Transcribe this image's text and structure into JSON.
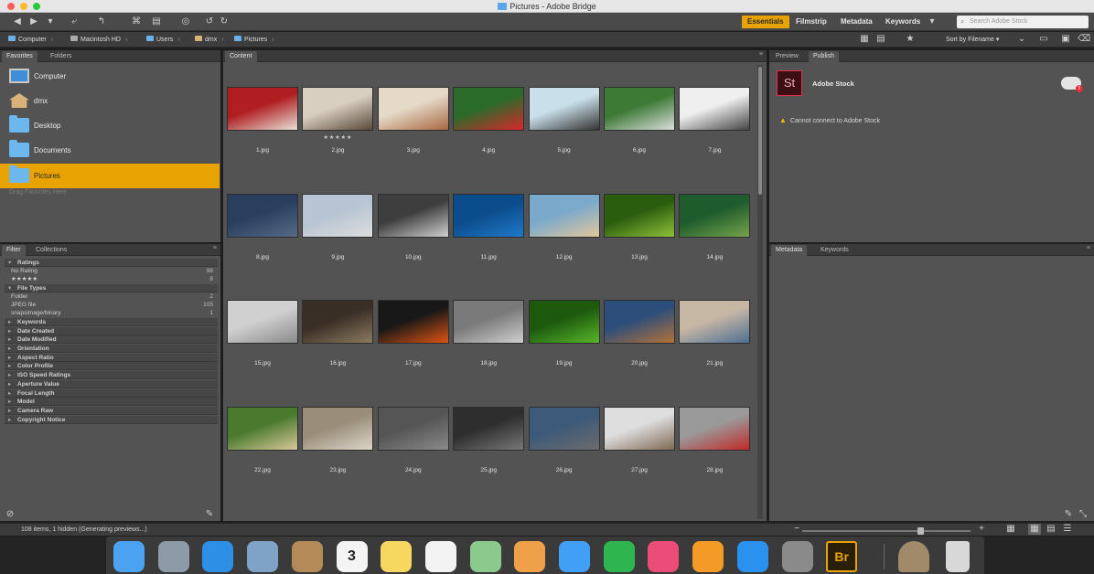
{
  "window": {
    "title": "Pictures - Adobe Bridge"
  },
  "toolbar": {
    "workspaces": [
      "Essentials",
      "Filmstrip",
      "Metadata",
      "Keywords"
    ],
    "active_workspace": "Essentials",
    "search_placeholder": "Search Adobe Stock"
  },
  "path": {
    "crumbs": [
      "Computer",
      "Macintosh HD",
      "Users",
      "dmx",
      "Pictures"
    ],
    "sort_label": "Sort by Filename"
  },
  "left_top_panel": {
    "tabs": [
      "Favorites",
      "Folders"
    ],
    "favorites": [
      {
        "label": "Computer",
        "icon": "computer-icon"
      },
      {
        "label": "dmx",
        "icon": "home-icon"
      },
      {
        "label": "Desktop",
        "icon": "folder-icon"
      },
      {
        "label": "Documents",
        "icon": "folder-icon"
      },
      {
        "label": "Pictures",
        "icon": "folder-icon",
        "selected": true
      }
    ],
    "hint": "Drag Favorites Here"
  },
  "filter_panel": {
    "tabs": [
      "Filter",
      "Collections"
    ],
    "sections": {
      "ratings": {
        "title": "Ratings",
        "rows": [
          {
            "label": "No Rating",
            "count": "98"
          },
          {
            "label": "★★★★★",
            "count": "8"
          }
        ]
      },
      "file_types": {
        "title": "File Types",
        "rows": [
          {
            "label": "Folder",
            "count": "2"
          },
          {
            "label": "JPEG file",
            "count": "105"
          },
          {
            "label": "snapsimage/binary",
            "count": "1"
          }
        ]
      },
      "collapsed": [
        "Keywords",
        "Date Created",
        "Date Modified",
        "Orientation",
        "Aspect Ratio",
        "Color Profile",
        "ISO Speed Ratings",
        "Aperture Value",
        "Focal Length",
        "Model",
        "Camera Raw",
        "Copyright Notice"
      ]
    }
  },
  "content_panel": {
    "tab": "Content",
    "thumbnails": [
      {
        "label": "1.jpg"
      },
      {
        "label": "2.jpg",
        "rating": "★★★★★"
      },
      {
        "label": "3.jpg"
      },
      {
        "label": "4.jpg"
      },
      {
        "label": "5.jpg"
      },
      {
        "label": "6.jpg"
      },
      {
        "label": "7.jpg"
      },
      {
        "label": "8.jpg"
      },
      {
        "label": "9.jpg"
      },
      {
        "label": "10.jpg"
      },
      {
        "label": "11.jpg"
      },
      {
        "label": "12.jpg"
      },
      {
        "label": "13.jpg"
      },
      {
        "label": "14.jpg"
      },
      {
        "label": "15.jpg"
      },
      {
        "label": "16.jpg"
      },
      {
        "label": "17.jpg"
      },
      {
        "label": "18.jpg"
      },
      {
        "label": "19.jpg"
      },
      {
        "label": "20.jpg"
      },
      {
        "label": "21.jpg"
      },
      {
        "label": "22.jpg"
      },
      {
        "label": "23.jpg"
      },
      {
        "label": "24.jpg"
      },
      {
        "label": "25.jpg"
      },
      {
        "label": "26.jpg"
      },
      {
        "label": "27.jpg"
      },
      {
        "label": "28.jpg"
      }
    ],
    "thumb_colors": [
      [
        "#b01e22",
        "#e7e2d8"
      ],
      [
        "#d9cfc1",
        "#5a4a3a"
      ],
      [
        "#e5d9c8",
        "#a86840"
      ],
      [
        "#2a6b2a",
        "#d9272b"
      ],
      [
        "#c9dfe9",
        "#333"
      ],
      [
        "#3d7a36",
        "#dcdcdc"
      ],
      [
        "#efefef",
        "#444"
      ],
      [
        "#2a3f5e",
        "#556b86"
      ],
      [
        "#b7c4d3",
        "#ddd"
      ],
      [
        "#3e3e3e",
        "#d0d0d0"
      ],
      [
        "#0b4c8c",
        "#1f78c8"
      ],
      [
        "#7ba9cc",
        "#e2c79a"
      ],
      [
        "#2b5d0f",
        "#8fc13a"
      ],
      [
        "#1f5c2d",
        "#76a44b"
      ],
      [
        "#d0d0d0",
        "#8a8a8a"
      ],
      [
        "#3a2f26",
        "#8d7a60"
      ],
      [
        "#181818",
        "#e05412"
      ],
      [
        "#7a7a7a",
        "#cfcfcf"
      ],
      [
        "#1d5a0e",
        "#58b62b"
      ],
      [
        "#2d4e7a",
        "#b57237"
      ],
      [
        "#c6b6a4",
        "#4e6e94"
      ],
      [
        "#4a7a2e",
        "#d8c89a"
      ],
      [
        "#9a8e7a",
        "#dcd6c9"
      ],
      [
        "#555",
        "#8a8a8a"
      ],
      [
        "#2e2e2e",
        "#777"
      ],
      [
        "#3d5a7a",
        "#6b6b6b"
      ],
      [
        "#dedede",
        "#7f6a55"
      ],
      [
        "#9a9a9a",
        "#c02a28"
      ]
    ]
  },
  "right_top_panel": {
    "tabs": [
      "Preview",
      "Publish"
    ],
    "stock_logo_text": "St",
    "stock_title": "Adobe Stock",
    "warning": "Cannot connect to Adobe Stock"
  },
  "right_bottom_panel": {
    "tabs": [
      "Metadata",
      "Keywords"
    ]
  },
  "status": {
    "text": "108 items, 1 hidden (Generating previews...)",
    "thumbnail_size_level": 0.7
  },
  "dock": {
    "apps": [
      {
        "name": "finder-icon",
        "color": "#4aa2f0"
      },
      {
        "name": "launchpad-icon",
        "color": "#8e9aa8"
      },
      {
        "name": "safari-icon",
        "color": "#2d8fe6"
      },
      {
        "name": "preview-icon",
        "color": "#7fa3c7"
      },
      {
        "name": "contacts-icon",
        "color": "#b38a58"
      },
      {
        "name": "calendar-icon",
        "color": "#f4f4f4",
        "text": "3"
      },
      {
        "name": "notes-icon",
        "color": "#f6d860"
      },
      {
        "name": "reminders-icon",
        "color": "#f3f3f3"
      },
      {
        "name": "maps-icon",
        "color": "#8cc98d"
      },
      {
        "name": "photos-icon",
        "color": "#f1a04a"
      },
      {
        "name": "messages-icon",
        "color": "#41a0f5"
      },
      {
        "name": "facetime-icon",
        "color": "#2fb54f"
      },
      {
        "name": "itunes-icon",
        "color": "#ec4c7a"
      },
      {
        "name": "ibooks-icon",
        "color": "#f49a27"
      },
      {
        "name": "app-store-icon",
        "color": "#2a91ee"
      },
      {
        "name": "system-preferences-icon",
        "color": "#8a8a8a"
      },
      {
        "name": "adobe-bridge-icon",
        "color": "#2a1f08",
        "text": "Br"
      }
    ],
    "trailing": [
      {
        "name": "downloads-stack-icon",
        "color": "#a08a6a"
      },
      {
        "name": "trash-icon",
        "color": "#d8d8d8"
      }
    ]
  }
}
